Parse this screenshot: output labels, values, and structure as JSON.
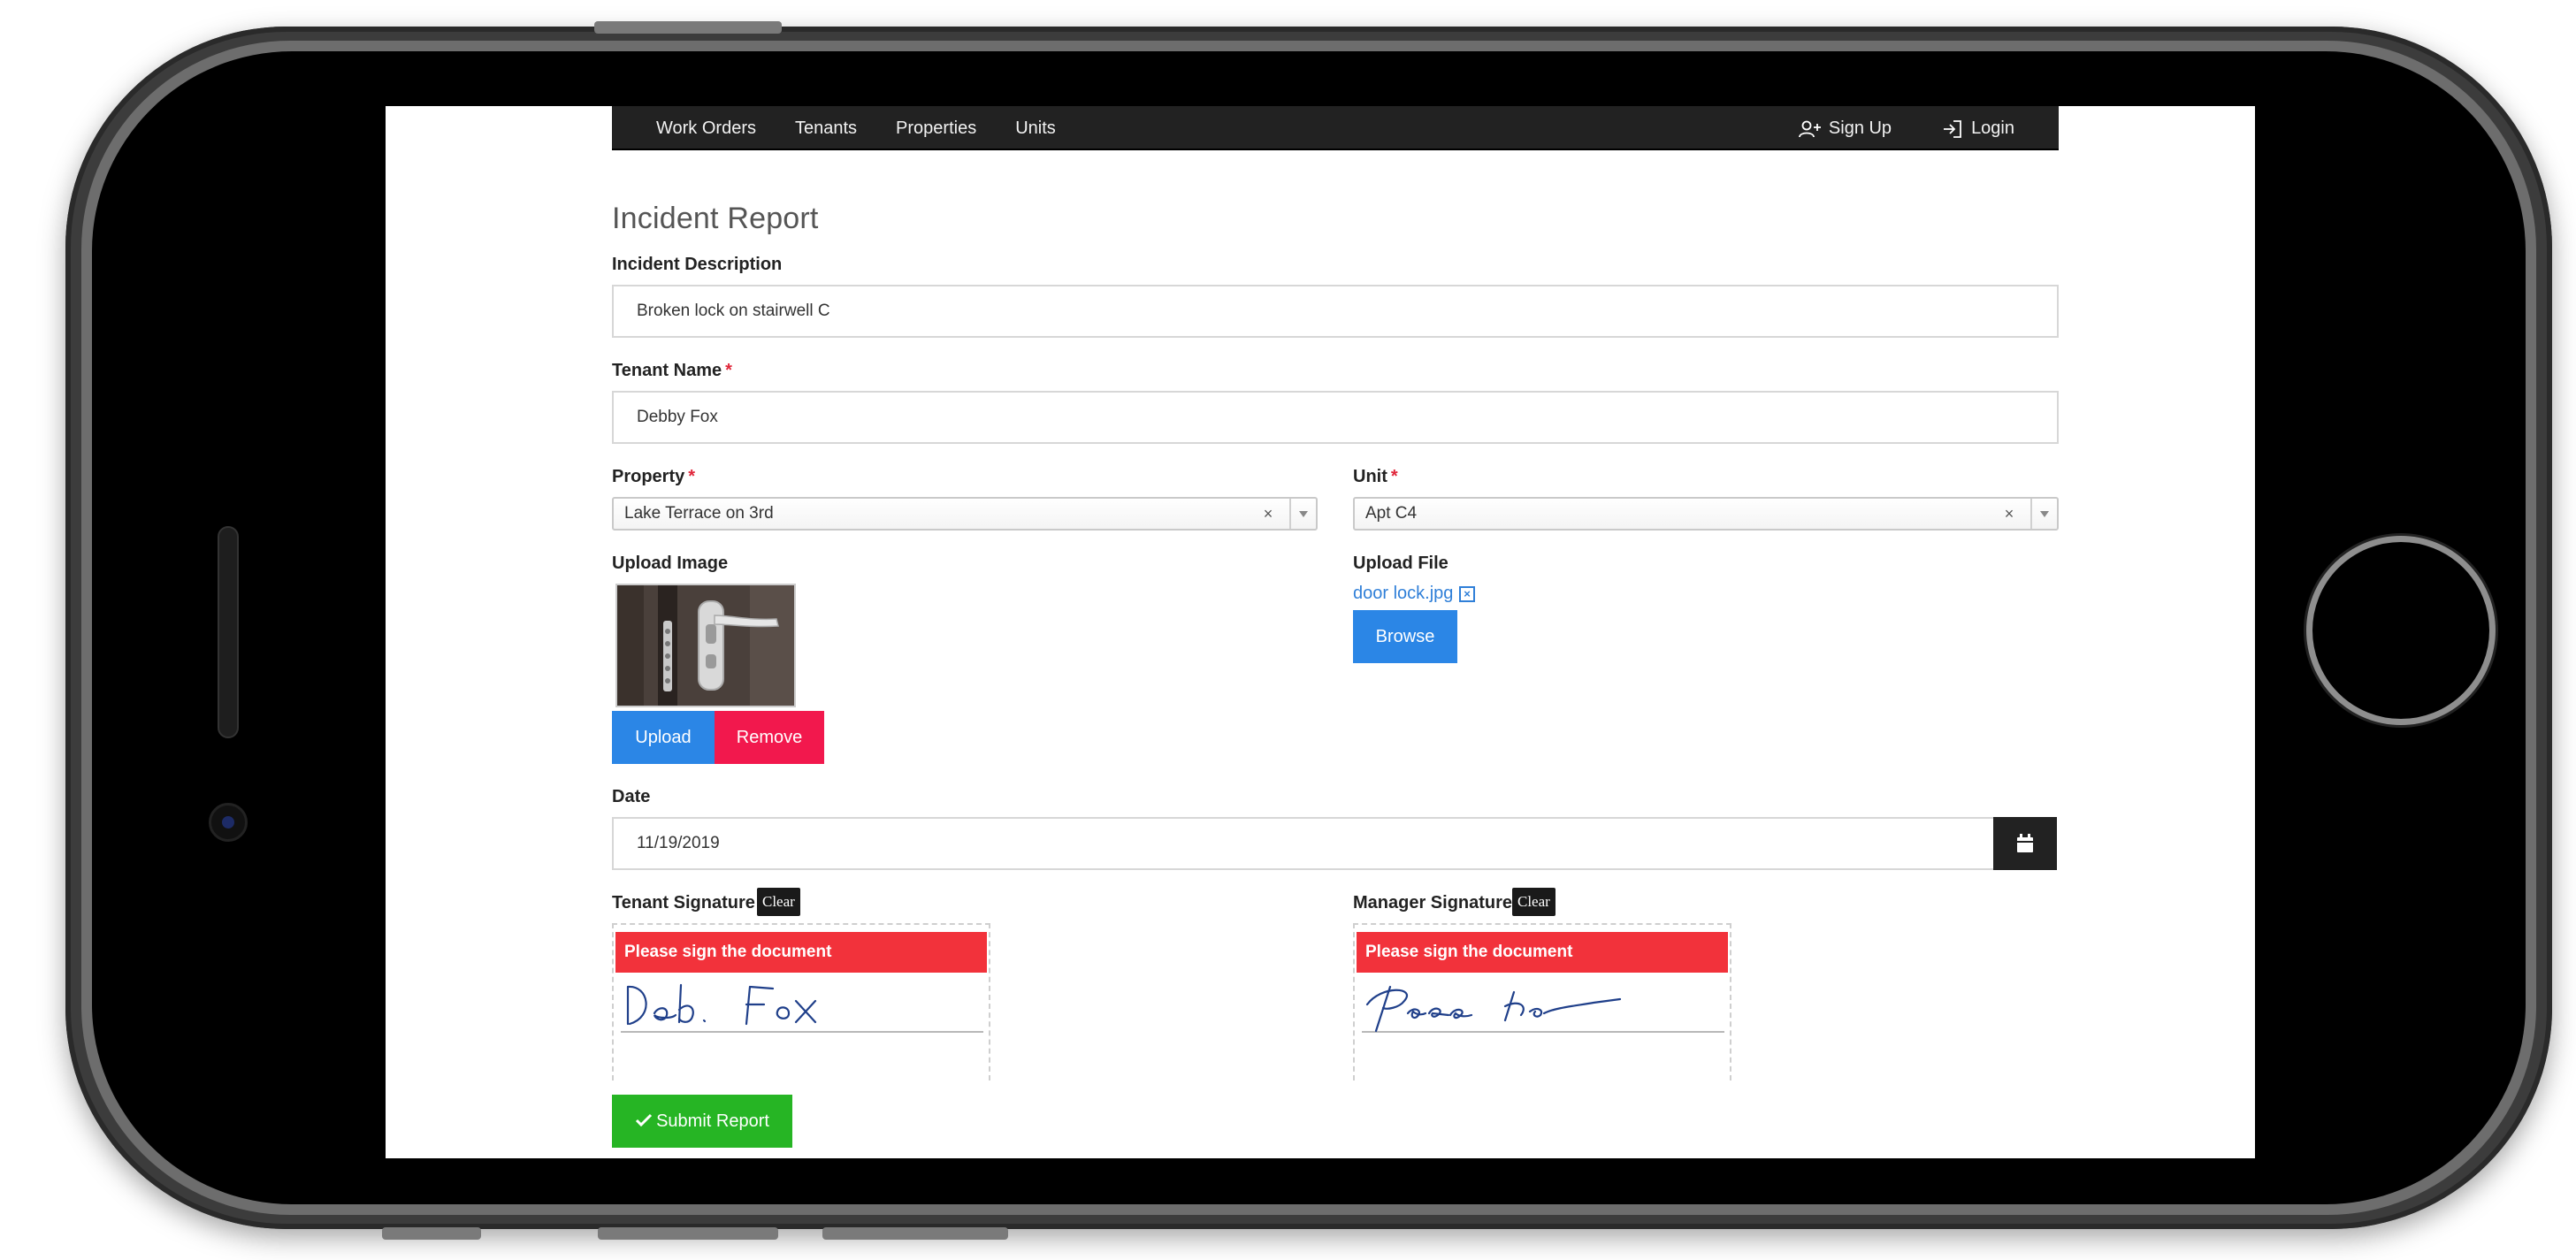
{
  "nav": {
    "left": [
      {
        "label": "Work Orders"
      },
      {
        "label": "Tenants"
      },
      {
        "label": "Properties"
      },
      {
        "label": "Units"
      }
    ],
    "signup": {
      "label": "Sign Up",
      "icon": "user-plus-icon"
    },
    "login": {
      "label": "Login",
      "icon": "sign-in-icon"
    }
  },
  "form": {
    "title": "Incident Report",
    "description": {
      "label": "Incident Description",
      "value": "Broken lock on stairwell C"
    },
    "tenant": {
      "label": "Tenant Name",
      "required": "*",
      "value": "Debby Fox"
    },
    "property": {
      "label": "Property",
      "required": "*",
      "value": "Lake Terrace on 3rd",
      "clear": "×"
    },
    "unit": {
      "label": "Unit",
      "required": "*",
      "value": "Apt C4",
      "clear": "×"
    },
    "upload_image": {
      "label": "Upload Image",
      "upload_label": "Upload",
      "remove_label": "Remove"
    },
    "upload_file": {
      "label": "Upload File",
      "file_name": "door lock.jpg",
      "remove_x": "×",
      "browse_label": "Browse"
    },
    "date": {
      "label": "Date",
      "value": "11/19/2019"
    },
    "tenant_signature": {
      "label": "Tenant Signature",
      "clear_label": "Clear",
      "alert": "Please sign the document"
    },
    "manager_signature": {
      "label": "Manager Signature",
      "clear_label": "Clear",
      "alert": "Please sign the document"
    },
    "submit_label": "Submit Report"
  },
  "colors": {
    "nav_bg": "#222222",
    "primary": "#2b86e6",
    "danger": "#f2184d",
    "success": "#26b524",
    "alert": "#f2323b",
    "link": "#2f7fd8",
    "signature_ink": "#1f3f8a"
  }
}
